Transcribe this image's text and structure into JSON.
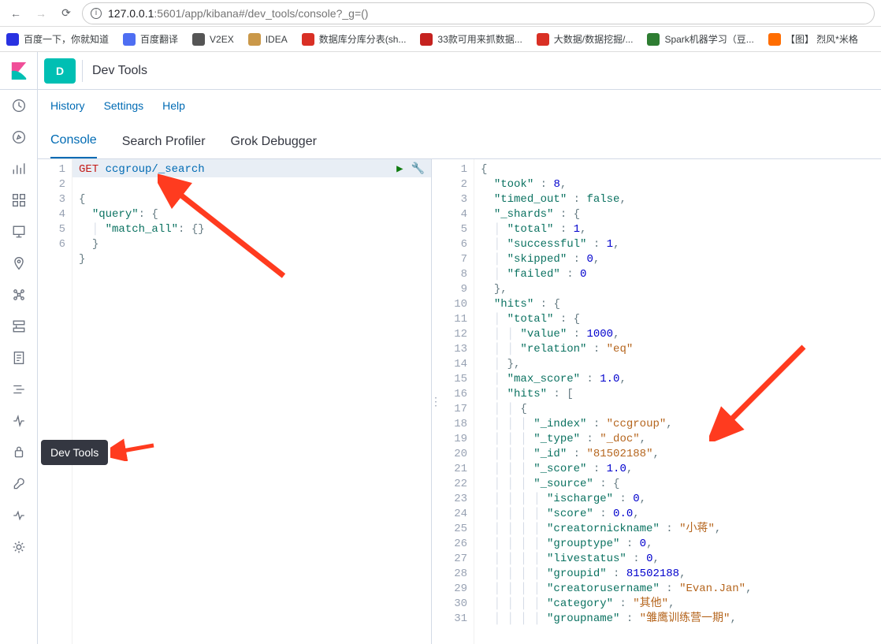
{
  "browser": {
    "url_host": "127.0.0.1",
    "url_port": ":5601",
    "url_path": "/app/kibana#/dev_tools/console?_g=()"
  },
  "bookmarks": [
    {
      "label": "百度一下，你就知道",
      "color": "#2932e1"
    },
    {
      "label": "百度翻译",
      "color": "#4e6ef2"
    },
    {
      "label": "V2EX",
      "color": "#555"
    },
    {
      "label": "IDEA",
      "color": "#ca9849"
    },
    {
      "label": "数据库分库分表(sh...",
      "color": "#d93025"
    },
    {
      "label": "33款可用来抓数据...",
      "color": "#c5221f"
    },
    {
      "label": "大数据/数据挖掘/...",
      "color": "#d93025"
    },
    {
      "label": "Spark机器学习（豆...",
      "color": "#2e7d32"
    },
    {
      "label": "【图】 烈风*米格",
      "color": "#ff6d00"
    }
  ],
  "topbar": {
    "tile": "D",
    "title": "Dev Tools"
  },
  "menu": {
    "history": "History",
    "settings": "Settings",
    "help": "Help"
  },
  "tabs": {
    "console": "Console",
    "profiler": "Search Profiler",
    "grok": "Grok Debugger"
  },
  "tooltip": "Dev Tools",
  "request_lines": [
    {
      "n": 1,
      "fold": "",
      "content": [
        {
          "t": "m",
          "v": "GET"
        },
        {
          "t": "sp",
          "v": " "
        },
        {
          "t": "p",
          "v": "ccgroup/_search"
        }
      ]
    },
    {
      "n": 2,
      "fold": "▾",
      "content": [
        {
          "t": "pu",
          "v": "{"
        }
      ]
    },
    {
      "n": 3,
      "fold": "▾",
      "content": [
        {
          "t": "sp",
          "v": "  "
        },
        {
          "t": "k",
          "v": "\"query\""
        },
        {
          "t": "pu",
          "v": ": {"
        }
      ]
    },
    {
      "n": 4,
      "fold": "",
      "content": [
        {
          "t": "il",
          "v": "  │ "
        },
        {
          "t": "k",
          "v": "\"match_all\""
        },
        {
          "t": "pu",
          "v": ": {}"
        }
      ]
    },
    {
      "n": 5,
      "fold": "▴",
      "content": [
        {
          "t": "sp",
          "v": "  "
        },
        {
          "t": "pu",
          "v": "}"
        }
      ]
    },
    {
      "n": 6,
      "fold": "▴",
      "content": [
        {
          "t": "pu",
          "v": "}"
        }
      ]
    }
  ],
  "response_lines": [
    {
      "n": 1,
      "fold": "▾",
      "content": [
        {
          "t": "pu",
          "v": "{"
        }
      ]
    },
    {
      "n": 2,
      "fold": "",
      "content": [
        {
          "t": "sp",
          "v": "  "
        },
        {
          "t": "k",
          "v": "\"took\""
        },
        {
          "t": "pu",
          "v": " : "
        },
        {
          "t": "n",
          "v": "8"
        },
        {
          "t": "pu",
          "v": ","
        }
      ]
    },
    {
      "n": 3,
      "fold": "",
      "content": [
        {
          "t": "sp",
          "v": "  "
        },
        {
          "t": "k",
          "v": "\"timed_out\""
        },
        {
          "t": "pu",
          "v": " : "
        },
        {
          "t": "b",
          "v": "false"
        },
        {
          "t": "pu",
          "v": ","
        }
      ]
    },
    {
      "n": 4,
      "fold": "▾",
      "content": [
        {
          "t": "sp",
          "v": "  "
        },
        {
          "t": "k",
          "v": "\"_shards\""
        },
        {
          "t": "pu",
          "v": " : {"
        }
      ]
    },
    {
      "n": 5,
      "fold": "",
      "content": [
        {
          "t": "il",
          "v": "  │ "
        },
        {
          "t": "k",
          "v": "\"total\""
        },
        {
          "t": "pu",
          "v": " : "
        },
        {
          "t": "n",
          "v": "1"
        },
        {
          "t": "pu",
          "v": ","
        }
      ]
    },
    {
      "n": 6,
      "fold": "",
      "content": [
        {
          "t": "il",
          "v": "  │ "
        },
        {
          "t": "k",
          "v": "\"successful\""
        },
        {
          "t": "pu",
          "v": " : "
        },
        {
          "t": "n",
          "v": "1"
        },
        {
          "t": "pu",
          "v": ","
        }
      ]
    },
    {
      "n": 7,
      "fold": "",
      "content": [
        {
          "t": "il",
          "v": "  │ "
        },
        {
          "t": "k",
          "v": "\"skipped\""
        },
        {
          "t": "pu",
          "v": " : "
        },
        {
          "t": "n",
          "v": "0"
        },
        {
          "t": "pu",
          "v": ","
        }
      ]
    },
    {
      "n": 8,
      "fold": "",
      "content": [
        {
          "t": "il",
          "v": "  │ "
        },
        {
          "t": "k",
          "v": "\"failed\""
        },
        {
          "t": "pu",
          "v": " : "
        },
        {
          "t": "n",
          "v": "0"
        }
      ]
    },
    {
      "n": 9,
      "fold": "▴",
      "content": [
        {
          "t": "sp",
          "v": "  "
        },
        {
          "t": "pu",
          "v": "},"
        }
      ]
    },
    {
      "n": 10,
      "fold": "▾",
      "content": [
        {
          "t": "sp",
          "v": "  "
        },
        {
          "t": "k",
          "v": "\"hits\""
        },
        {
          "t": "pu",
          "v": " : {"
        }
      ]
    },
    {
      "n": 11,
      "fold": "▾",
      "content": [
        {
          "t": "il",
          "v": "  │ "
        },
        {
          "t": "k",
          "v": "\"total\""
        },
        {
          "t": "pu",
          "v": " : {"
        }
      ]
    },
    {
      "n": 12,
      "fold": "",
      "content": [
        {
          "t": "il",
          "v": "  │ │ "
        },
        {
          "t": "k",
          "v": "\"value\""
        },
        {
          "t": "pu",
          "v": " : "
        },
        {
          "t": "n",
          "v": "1000"
        },
        {
          "t": "pu",
          "v": ","
        }
      ]
    },
    {
      "n": 13,
      "fold": "",
      "content": [
        {
          "t": "il",
          "v": "  │ │ "
        },
        {
          "t": "k",
          "v": "\"relation\""
        },
        {
          "t": "pu",
          "v": " : "
        },
        {
          "t": "s",
          "v": "\"eq\""
        }
      ]
    },
    {
      "n": 14,
      "fold": "▴",
      "content": [
        {
          "t": "il",
          "v": "  │ "
        },
        {
          "t": "pu",
          "v": "},"
        }
      ]
    },
    {
      "n": 15,
      "fold": "",
      "content": [
        {
          "t": "il",
          "v": "  │ "
        },
        {
          "t": "k",
          "v": "\"max_score\""
        },
        {
          "t": "pu",
          "v": " : "
        },
        {
          "t": "n",
          "v": "1.0"
        },
        {
          "t": "pu",
          "v": ","
        }
      ]
    },
    {
      "n": 16,
      "fold": "▾",
      "content": [
        {
          "t": "il",
          "v": "  │ "
        },
        {
          "t": "k",
          "v": "\"hits\""
        },
        {
          "t": "pu",
          "v": " : ["
        }
      ]
    },
    {
      "n": 17,
      "fold": "▾",
      "content": [
        {
          "t": "il",
          "v": "  │ │ "
        },
        {
          "t": "pu",
          "v": "{"
        }
      ]
    },
    {
      "n": 18,
      "fold": "",
      "content": [
        {
          "t": "il",
          "v": "  │ │ │ "
        },
        {
          "t": "k",
          "v": "\"_index\""
        },
        {
          "t": "pu",
          "v": " : "
        },
        {
          "t": "s",
          "v": "\"ccgroup\""
        },
        {
          "t": "pu",
          "v": ","
        }
      ]
    },
    {
      "n": 19,
      "fold": "",
      "content": [
        {
          "t": "il",
          "v": "  │ │ │ "
        },
        {
          "t": "k",
          "v": "\"_type\""
        },
        {
          "t": "pu",
          "v": " : "
        },
        {
          "t": "s",
          "v": "\"_doc\""
        },
        {
          "t": "pu",
          "v": ","
        }
      ]
    },
    {
      "n": 20,
      "fold": "",
      "content": [
        {
          "t": "il",
          "v": "  │ │ │ "
        },
        {
          "t": "k",
          "v": "\"_id\""
        },
        {
          "t": "pu",
          "v": " : "
        },
        {
          "t": "s",
          "v": "\"81502188\""
        },
        {
          "t": "pu",
          "v": ","
        }
      ]
    },
    {
      "n": 21,
      "fold": "",
      "content": [
        {
          "t": "il",
          "v": "  │ │ │ "
        },
        {
          "t": "k",
          "v": "\"_score\""
        },
        {
          "t": "pu",
          "v": " : "
        },
        {
          "t": "n",
          "v": "1.0"
        },
        {
          "t": "pu",
          "v": ","
        }
      ]
    },
    {
      "n": 22,
      "fold": "▾",
      "content": [
        {
          "t": "il",
          "v": "  │ │ │ "
        },
        {
          "t": "k",
          "v": "\"_source\""
        },
        {
          "t": "pu",
          "v": " : {"
        }
      ]
    },
    {
      "n": 23,
      "fold": "",
      "content": [
        {
          "t": "il",
          "v": "  │ │ │ │ "
        },
        {
          "t": "k",
          "v": "\"ischarge\""
        },
        {
          "t": "pu",
          "v": " : "
        },
        {
          "t": "n",
          "v": "0"
        },
        {
          "t": "pu",
          "v": ","
        }
      ]
    },
    {
      "n": 24,
      "fold": "",
      "content": [
        {
          "t": "il",
          "v": "  │ │ │ │ "
        },
        {
          "t": "k",
          "v": "\"score\""
        },
        {
          "t": "pu",
          "v": " : "
        },
        {
          "t": "n",
          "v": "0.0"
        },
        {
          "t": "pu",
          "v": ","
        }
      ]
    },
    {
      "n": 25,
      "fold": "",
      "content": [
        {
          "t": "il",
          "v": "  │ │ │ │ "
        },
        {
          "t": "k",
          "v": "\"creatornickname\""
        },
        {
          "t": "pu",
          "v": " : "
        },
        {
          "t": "s",
          "v": "\"小蒋\""
        },
        {
          "t": "pu",
          "v": ","
        }
      ]
    },
    {
      "n": 26,
      "fold": "",
      "content": [
        {
          "t": "il",
          "v": "  │ │ │ │ "
        },
        {
          "t": "k",
          "v": "\"grouptype\""
        },
        {
          "t": "pu",
          "v": " : "
        },
        {
          "t": "n",
          "v": "0"
        },
        {
          "t": "pu",
          "v": ","
        }
      ]
    },
    {
      "n": 27,
      "fold": "",
      "content": [
        {
          "t": "il",
          "v": "  │ │ │ │ "
        },
        {
          "t": "k",
          "v": "\"livestatus\""
        },
        {
          "t": "pu",
          "v": " : "
        },
        {
          "t": "n",
          "v": "0"
        },
        {
          "t": "pu",
          "v": ","
        }
      ]
    },
    {
      "n": 28,
      "fold": "",
      "content": [
        {
          "t": "il",
          "v": "  │ │ │ │ "
        },
        {
          "t": "k",
          "v": "\"groupid\""
        },
        {
          "t": "pu",
          "v": " : "
        },
        {
          "t": "n",
          "v": "81502188"
        },
        {
          "t": "pu",
          "v": ","
        }
      ]
    },
    {
      "n": 29,
      "fold": "",
      "content": [
        {
          "t": "il",
          "v": "  │ │ │ │ "
        },
        {
          "t": "k",
          "v": "\"creatorusername\""
        },
        {
          "t": "pu",
          "v": " : "
        },
        {
          "t": "s",
          "v": "\"Evan.Jan\""
        },
        {
          "t": "pu",
          "v": ","
        }
      ]
    },
    {
      "n": 30,
      "fold": "",
      "content": [
        {
          "t": "il",
          "v": "  │ │ │ │ "
        },
        {
          "t": "k",
          "v": "\"category\""
        },
        {
          "t": "pu",
          "v": " : "
        },
        {
          "t": "s",
          "v": "\"其他\""
        },
        {
          "t": "pu",
          "v": ","
        }
      ]
    },
    {
      "n": 31,
      "fold": "",
      "content": [
        {
          "t": "il",
          "v": "  │ │ │ │ "
        },
        {
          "t": "k",
          "v": "\"groupname\""
        },
        {
          "t": "pu",
          "v": " : "
        },
        {
          "t": "s",
          "v": "\"雏鹰训练营一期\""
        },
        {
          "t": "pu",
          "v": ","
        }
      ]
    }
  ]
}
